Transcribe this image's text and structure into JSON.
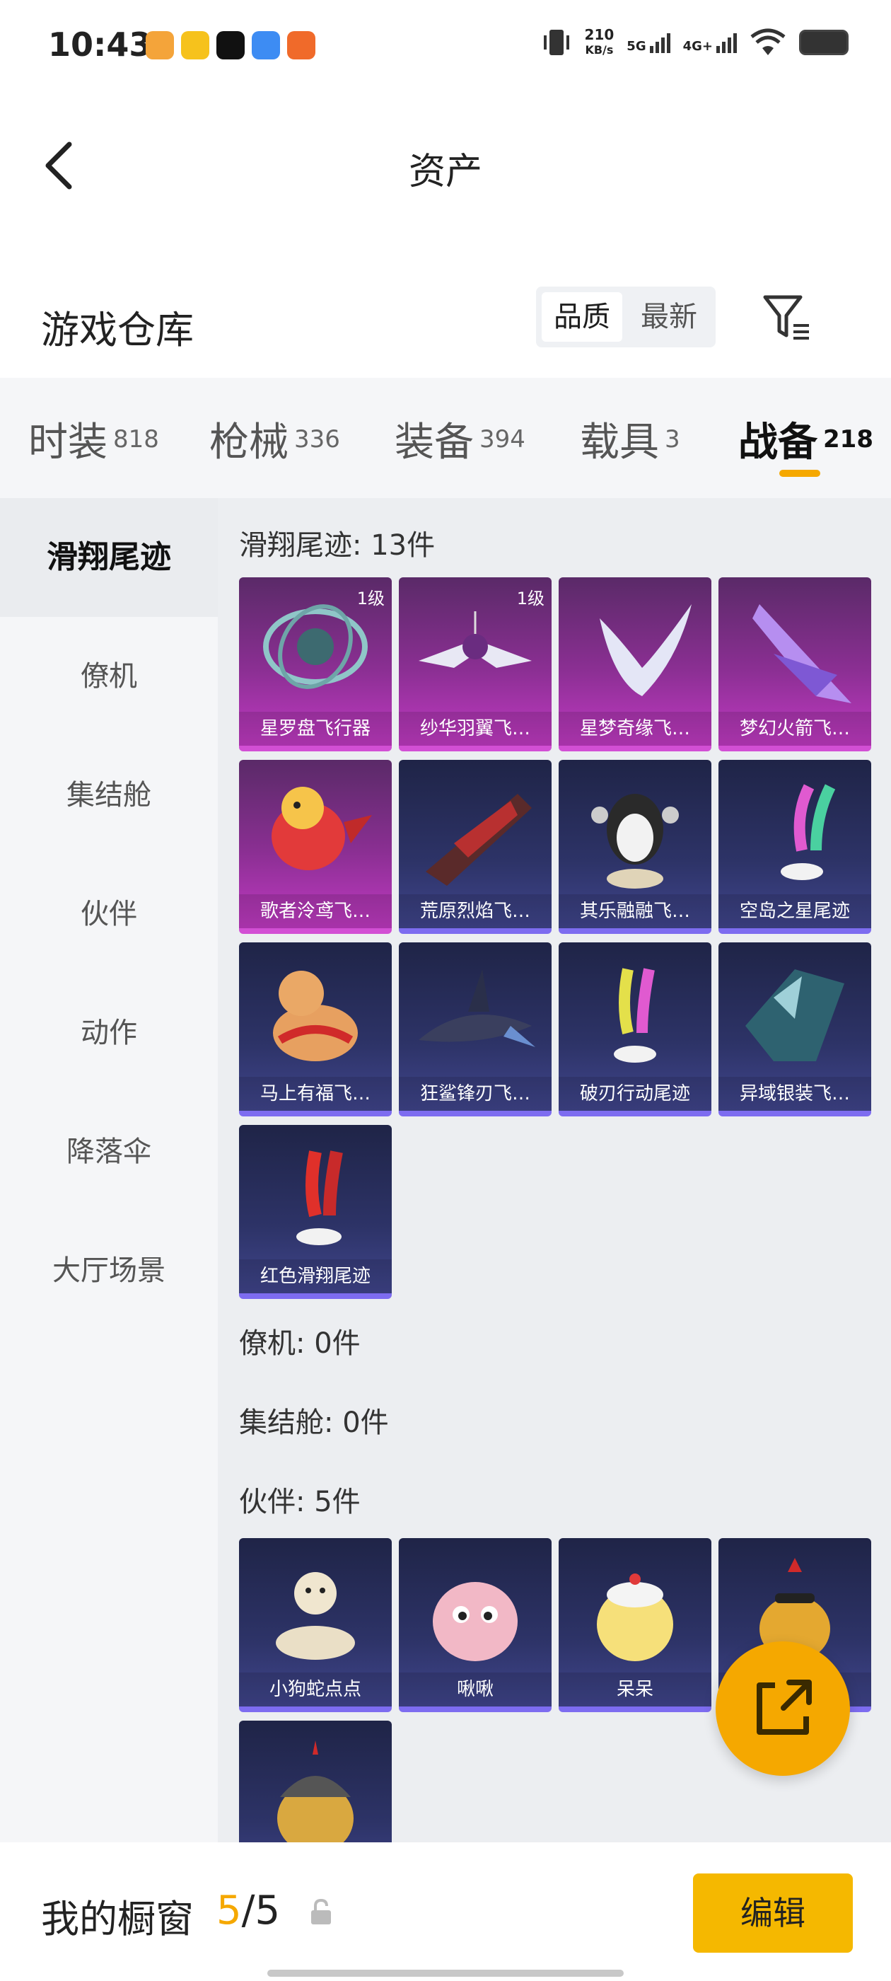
{
  "status_bar": {
    "time": "10:43",
    "net_speed_value": "210",
    "net_speed_unit": "KB/s",
    "net1": "5G",
    "net2": "4G+"
  },
  "header": {
    "title": "资产"
  },
  "warehouse": {
    "title": "游戏仓库",
    "sort_quality": "品质",
    "sort_latest": "最新"
  },
  "tabs": [
    {
      "label": "时装",
      "count": "818"
    },
    {
      "label": "枪械",
      "count": "336"
    },
    {
      "label": "装备",
      "count": "394"
    },
    {
      "label": "载具",
      "count": "3"
    },
    {
      "label": "战备",
      "count": "218"
    }
  ],
  "sidebar": [
    "滑翔尾迹",
    "僚机",
    "集结舱",
    "伙伴",
    "动作",
    "降落伞",
    "大厅场景"
  ],
  "sections": {
    "glide": {
      "title": "滑翔尾迹: 13件"
    },
    "wingman": {
      "title": "僚机: 0件"
    },
    "pod": {
      "title": "集结舱: 0件"
    },
    "partner": {
      "title": "伙伴: 5件"
    }
  },
  "glide_items": [
    {
      "name": "星罗盘飞行器",
      "level": "1级"
    },
    {
      "name": "纱华羽翼飞…",
      "level": "1级"
    },
    {
      "name": "星梦奇缘飞…"
    },
    {
      "name": "梦幻火箭飞…"
    },
    {
      "name": "歌者泠鸢飞…"
    },
    {
      "name": "荒原烈焰飞…"
    },
    {
      "name": "其乐融融飞…"
    },
    {
      "name": "空岛之星尾迹"
    },
    {
      "name": "马上有福飞…"
    },
    {
      "name": "狂鲨锋刃飞…"
    },
    {
      "name": "破刃行动尾迹"
    },
    {
      "name": "异域银装飞…"
    },
    {
      "name": "红色滑翔尾迹"
    }
  ],
  "partner_items": [
    {
      "name": "小狗蛇点点"
    },
    {
      "name": "啾啾"
    },
    {
      "name": "呆呆"
    },
    {
      "name": ""
    },
    {
      "name": ""
    }
  ],
  "bottom": {
    "title": "我的橱窗",
    "current": "5",
    "total": "/5",
    "edit": "编辑"
  },
  "colors": {
    "accent": "#f5a800",
    "purple_card": "#9a34a0",
    "blue_card": "#2d3367"
  }
}
